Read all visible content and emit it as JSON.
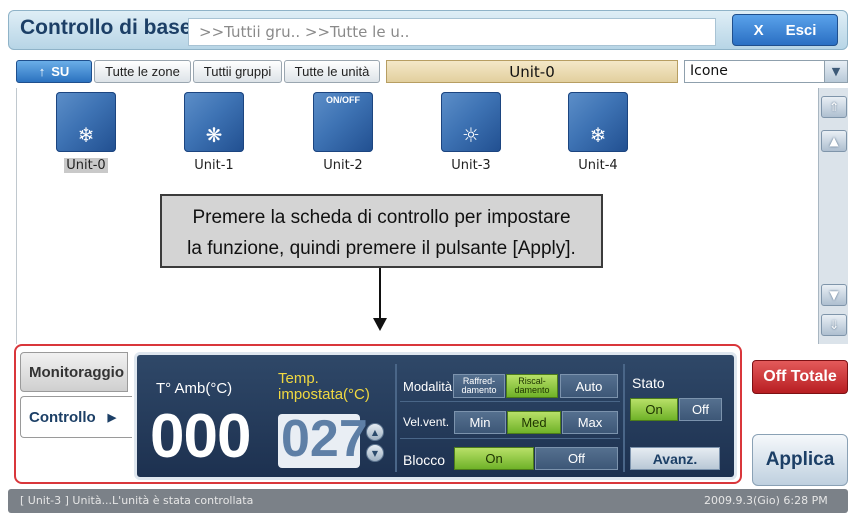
{
  "header": {
    "title": "Controllo di base",
    "breadcrumb": ">>Tuttii gru.. >>Tutte le u..",
    "exit_label": "Esci",
    "exit_icon": "X"
  },
  "toolbar": {
    "up_label": "SU",
    "up_icon": "↑",
    "zones_label": "Tutte le zone",
    "groups_label": "Tuttii gruppi",
    "units_label": "Tutte le unità",
    "selected_unit": "Unit-0",
    "view_select": "Icone"
  },
  "units": [
    {
      "label": "Unit-0",
      "glyph": "❄",
      "selected": true
    },
    {
      "label": "Unit-1",
      "glyph": "❋"
    },
    {
      "label": "Unit-2",
      "overlay": "ON/OFF"
    },
    {
      "label": "Unit-3",
      "glyph": "☼"
    },
    {
      "label": "Unit-4",
      "glyph": "❄"
    }
  ],
  "tooltip": {
    "line1": "Premere la scheda di controllo per impostare",
    "line2": "la funzione, quindi premere il pulsante [Apply]."
  },
  "scroll": {
    "top_icon": "⇑",
    "up_icon": "▲",
    "down_icon": "▼",
    "bottom_icon": "⇓"
  },
  "tabs": {
    "monitor": "Monitoraggio",
    "control": "Controllo",
    "control_arrow": "▶"
  },
  "control": {
    "amb_label": "T° Amb(°C)",
    "amb_value": "000",
    "set_label_1": "Temp.",
    "set_label_2": "impostata(°C)",
    "set_value": "027",
    "mode_label": "Modalità",
    "mode_cool_1": "Raffred-",
    "mode_cool_2": "damento",
    "mode_heat_1": "Riscal-",
    "mode_heat_2": "damento",
    "mode_auto": "Auto",
    "fan_label": "Vel.vent.",
    "fan_min": "Min",
    "fan_med": "Med",
    "fan_max": "Max",
    "lock_label": "Blocco",
    "lock_on": "On",
    "lock_off": "Off",
    "state_label": "Stato",
    "state_on": "On",
    "state_off": "Off",
    "advanced": "Avanz."
  },
  "actions": {
    "off_total": "Off Totale",
    "apply": "Applica"
  },
  "status": {
    "message": "[ Unit-3 ] Unità...L'unità è stata controllata",
    "time": "2009.9.3(Gio)  6:28 PM"
  },
  "colors": {
    "accent": "#2a6fc3",
    "highlight_frame": "#d9363b",
    "active_green": "#6fb228",
    "panel_bg": "#1d3150"
  }
}
